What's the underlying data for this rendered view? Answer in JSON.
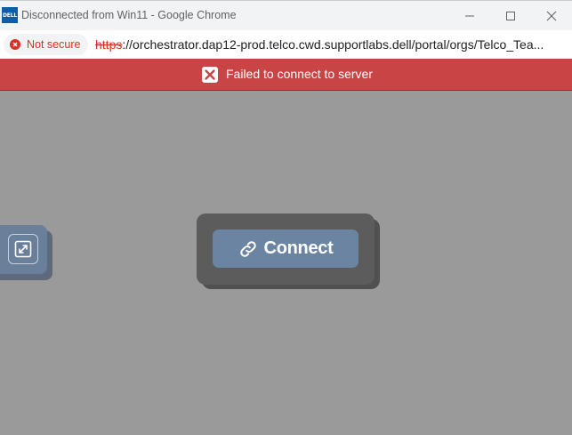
{
  "window": {
    "title": "Disconnected from Win11 - Google Chrome",
    "app_icon_text": "DELL"
  },
  "address_bar": {
    "security_label": "Not secure",
    "url_scheme": "https",
    "url_rest": "://orchestrator.dap12-prod.telco.cwd.supportlabs.dell/portal/orgs/Telco_Tea..."
  },
  "banner": {
    "message": "Failed to connect to server",
    "icon": "close-square-icon",
    "color": "#c94444"
  },
  "main": {
    "connect_label": "Connect",
    "connect_icon": "link-icon",
    "fullscreen_icon": "fullscreen-icon",
    "accent_color": "#6a84a2"
  }
}
